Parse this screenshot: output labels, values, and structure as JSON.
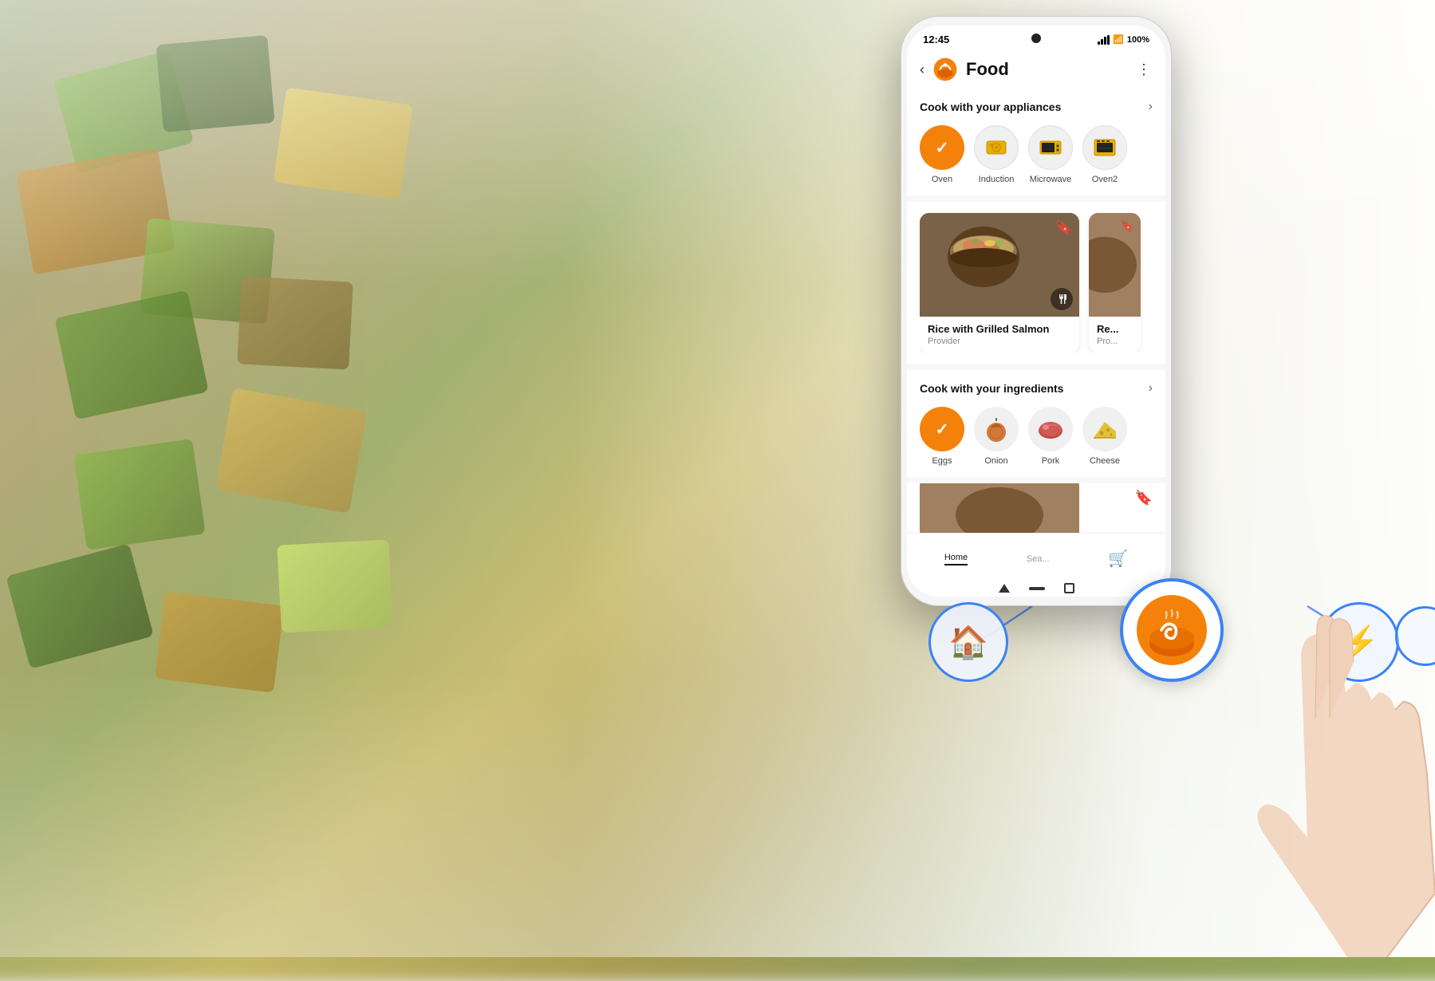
{
  "background": {
    "alt": "Blurred vegetables in wooden boxes"
  },
  "statusBar": {
    "time": "12:45",
    "signal": "full",
    "battery": "100%"
  },
  "appHeader": {
    "backLabel": "‹",
    "title": "Food",
    "moreLabel": "⋮"
  },
  "sections": [
    {
      "id": "appliances",
      "title": "Cook with your appliances",
      "arrowLabel": "›",
      "items": [
        {
          "id": "oven",
          "label": "Oven",
          "selected": true,
          "icon": "✓"
        },
        {
          "id": "induction",
          "label": "Induction",
          "selected": false,
          "icon": "🔘"
        },
        {
          "id": "microwave",
          "label": "Microwave",
          "selected": false,
          "icon": "📺"
        },
        {
          "id": "oven2",
          "label": "Oven2",
          "selected": false,
          "icon": "🟨"
        }
      ]
    },
    {
      "id": "ingredients",
      "title": "Cook with your ingredients",
      "arrowLabel": "›",
      "items": [
        {
          "id": "eggs",
          "label": "Eggs",
          "selected": true,
          "icon": "✓"
        },
        {
          "id": "onion",
          "label": "Onion",
          "selected": false,
          "icon": "🧅"
        },
        {
          "id": "pork",
          "label": "Pork",
          "selected": false,
          "icon": "🥩"
        },
        {
          "id": "cheese",
          "label": "Cheese",
          "selected": false,
          "icon": "🧀"
        }
      ]
    }
  ],
  "recipes": [
    {
      "id": "recipe1",
      "name": "Rice with Grilled Salmon",
      "provider": "Provider",
      "hasBookmark": true
    },
    {
      "id": "recipe2",
      "name": "Re...",
      "provider": "Pro...",
      "hasBookmark": true
    }
  ],
  "bottomNav": [
    {
      "id": "home",
      "label": "Home",
      "icon": "🏠",
      "active": true
    },
    {
      "id": "search",
      "label": "Sea...",
      "icon": "🔍",
      "active": false
    },
    {
      "id": "cart",
      "label": "",
      "icon": "🛒",
      "active": false
    }
  ],
  "floatingCircles": {
    "left": {
      "icon": "✉",
      "label": "home-icon",
      "size": 100
    },
    "center": {
      "icon": "🍜",
      "label": "food-app-icon",
      "size": 130
    },
    "right": {
      "icon": "⚡",
      "label": "power-icon",
      "size": 100
    }
  },
  "colors": {
    "accent": "#f4820a",
    "blue": "#3b82f6",
    "text": "#111111",
    "subtext": "#888888",
    "bg": "#f8f8f8",
    "white": "#ffffff"
  }
}
